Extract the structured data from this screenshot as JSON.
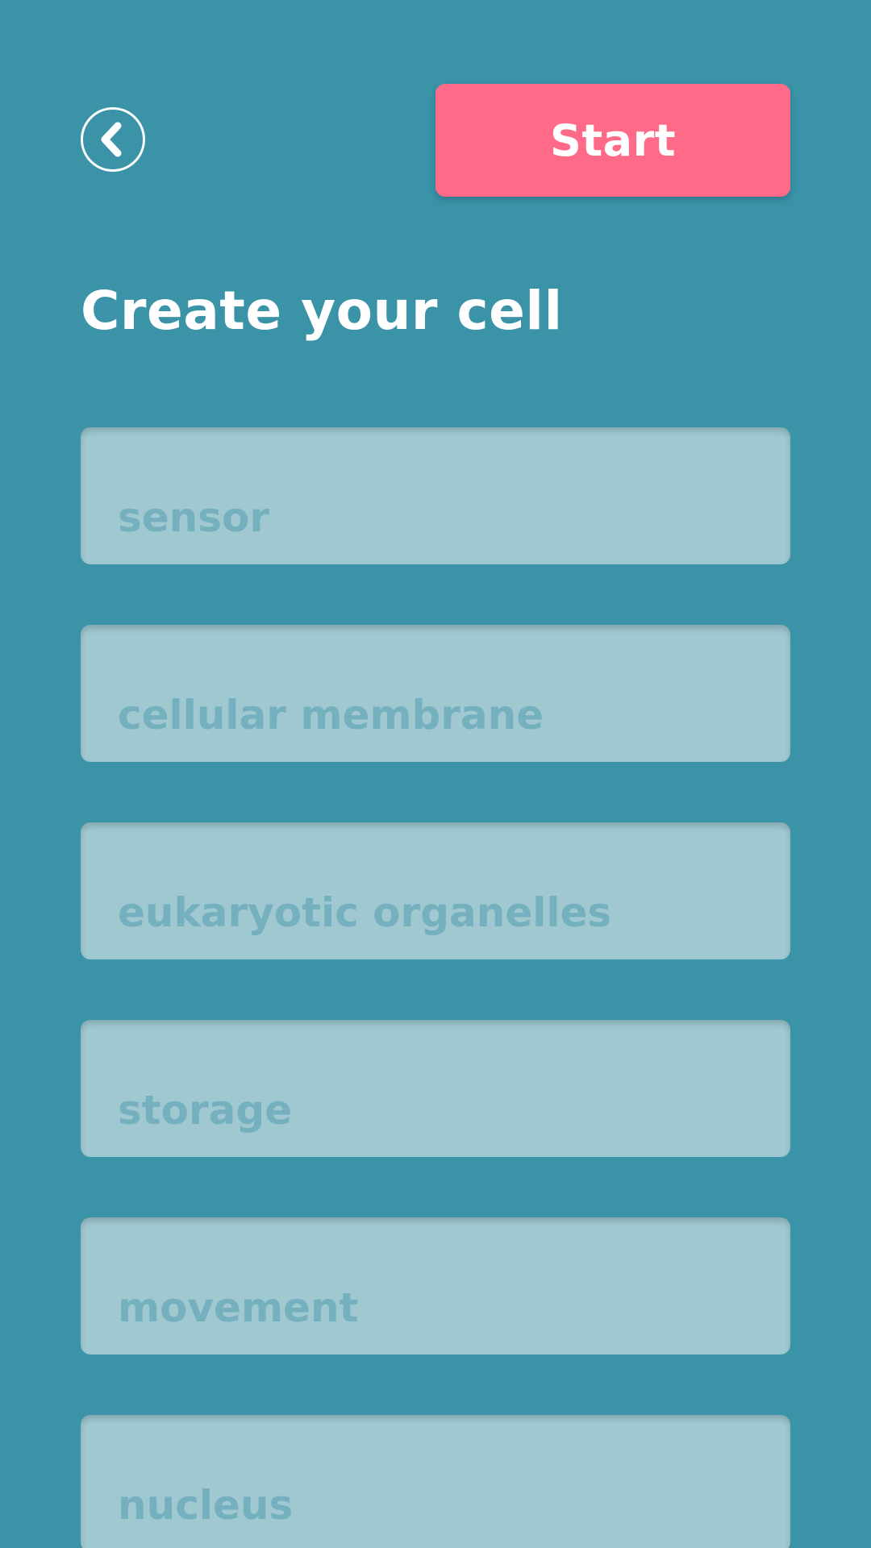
{
  "header": {
    "back_icon": "chevron-left-icon",
    "start_label": "Start"
  },
  "page_title": "Create your cell",
  "fields": [
    {
      "placeholder": "sensor"
    },
    {
      "placeholder": "cellular membrane"
    },
    {
      "placeholder": "eukaryotic organelles"
    },
    {
      "placeholder": "storage"
    },
    {
      "placeholder": "movement"
    },
    {
      "placeholder": "nucleus"
    }
  ],
  "colors": {
    "background": "#3b93a8",
    "accent": "#ff6a89",
    "field_background": "#9fc8d1",
    "placeholder_text": "#75b0bf",
    "text": "#ffffff"
  }
}
